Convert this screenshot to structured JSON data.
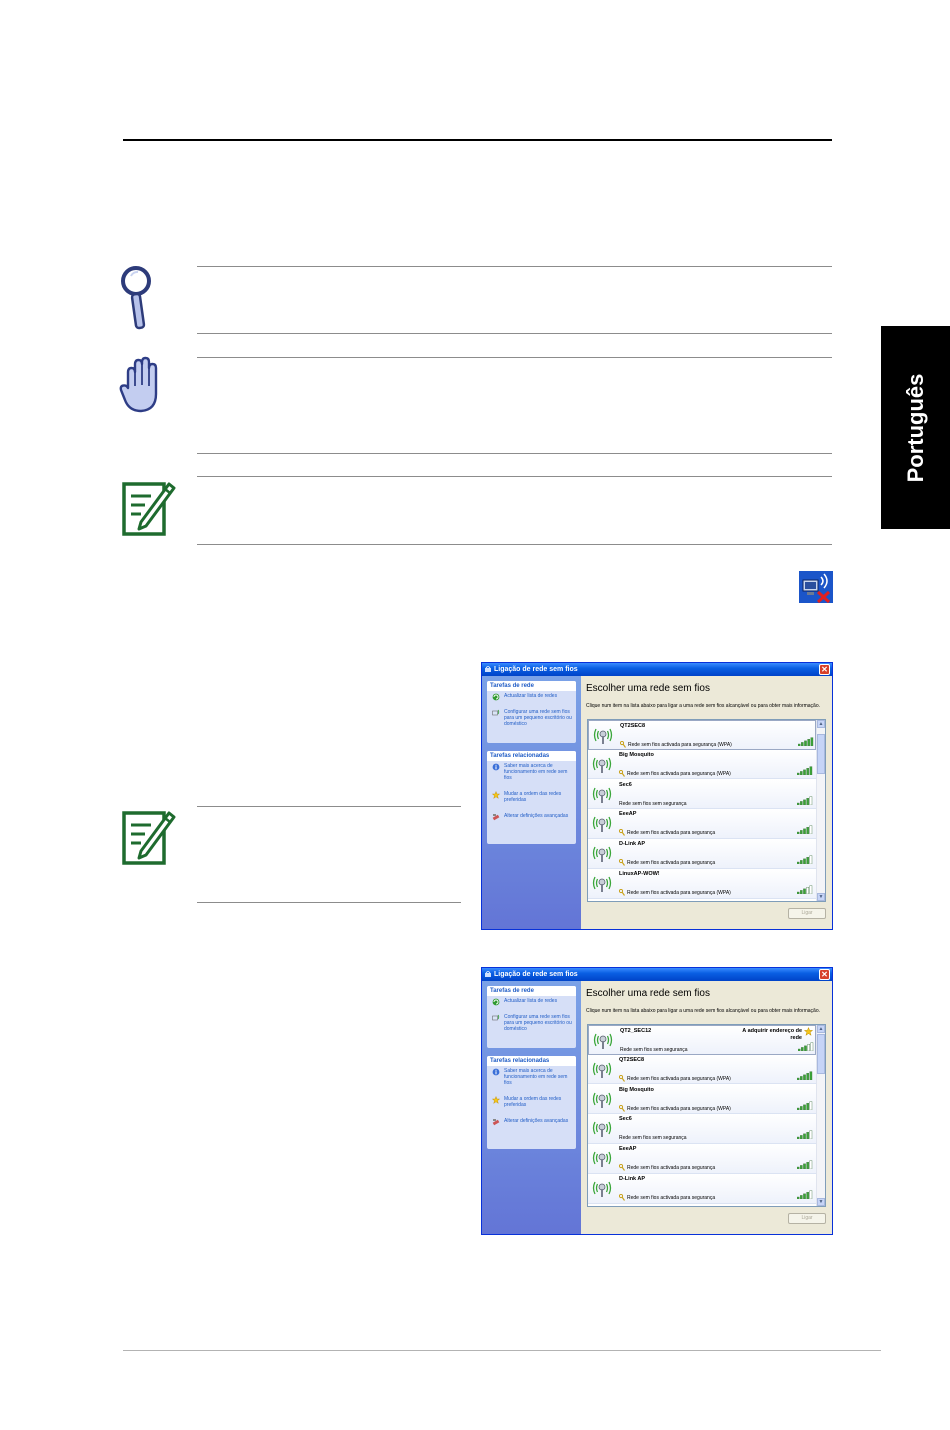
{
  "sidebar_tab": {
    "label": "Português"
  },
  "dialogs": [
    {
      "title": "Ligação de rede sem fios",
      "close_symbol": "✕",
      "tasks_header": "Tarefas de rede",
      "tasks": [
        {
          "label": "Actualizar lista de redes",
          "icon": "refresh-icon"
        },
        {
          "label": "Configurar uma rede sem fios para um pequeno escritório ou doméstico",
          "icon": "setup-network-icon"
        }
      ],
      "related_header": "Tarefas relacionadas",
      "related": [
        {
          "label": "Saber mais acerca de funcionamento em rede sem fios",
          "icon": "info-icon"
        },
        {
          "label": "Mudar a ordem das redes preferidas",
          "icon": "star-icon"
        },
        {
          "label": "Alterar definições avançadas",
          "icon": "settings-icon"
        }
      ],
      "main_title": "Escolher uma rede sem fios",
      "main_desc": "Clique num item na lista abaixo para ligar a uma rede sem fios alcançável ou para obter mais informação.",
      "networks": [
        {
          "name": "QT2SEC8",
          "status": "Rede sem fios activada para segurança (WPA)",
          "secured": true,
          "signal": 5
        },
        {
          "name": "Big Mosquito",
          "status": "Rede sem fios activada para segurança (WPA)",
          "secured": true,
          "signal": 5
        },
        {
          "name": "Sec6",
          "status": "Rede sem fios sem segurança",
          "secured": false,
          "signal": 4
        },
        {
          "name": "EeeAP",
          "status": "Rede sem fios activada para segurança",
          "secured": true,
          "signal": 4
        },
        {
          "name": "D-Link AP",
          "status": "Rede sem fios activada para segurança",
          "secured": true,
          "signal": 4
        },
        {
          "name": "LinuxAP-WOW!",
          "status": "Rede sem fios activada para segurança (WPA)",
          "secured": true,
          "signal": 3
        }
      ],
      "connect_label": "Ligar"
    },
    {
      "title": "Ligação de rede sem fios",
      "close_symbol": "✕",
      "tasks_header": "Tarefas de rede",
      "tasks": [
        {
          "label": "Actualizar lista de redes",
          "icon": "refresh-icon"
        },
        {
          "label": "Configurar uma rede sem fios para um pequeno escritório ou doméstico",
          "icon": "setup-network-icon"
        }
      ],
      "related_header": "Tarefas relacionadas",
      "related": [
        {
          "label": "Saber mais acerca de funcionamento em rede sem fios",
          "icon": "info-icon"
        },
        {
          "label": "Mudar a ordem das redes preferidas",
          "icon": "star-icon"
        },
        {
          "label": "Alterar definições avançadas",
          "icon": "settings-icon"
        }
      ],
      "main_title": "Escolher uma rede sem fios",
      "main_desc": "Clique num item na lista abaixo para ligar a uma rede sem fios alcançável ou para obter mais informação.",
      "networks": [
        {
          "name": "QT2_SEC12",
          "status": "Rede sem fios sem segurança",
          "secured": false,
          "signal": 3,
          "acquiring": "A adquirir endereço de rede"
        },
        {
          "name": "QT2SEC8",
          "status": "Rede sem fios activada para segurança (WPA)",
          "secured": true,
          "signal": 5
        },
        {
          "name": "Big Mosquito",
          "status": "Rede sem fios activada para segurança (WPA)",
          "secured": true,
          "signal": 4
        },
        {
          "name": "Sec6",
          "status": "Rede sem fios sem segurança",
          "secured": false,
          "signal": 4
        },
        {
          "name": "EeeAP",
          "status": "Rede sem fios activada para segurança",
          "secured": true,
          "signal": 4
        },
        {
          "name": "D-Link AP",
          "status": "Rede sem fios activada para segurança",
          "secured": true,
          "signal": 4
        }
      ],
      "connect_label": "Ligar"
    }
  ]
}
